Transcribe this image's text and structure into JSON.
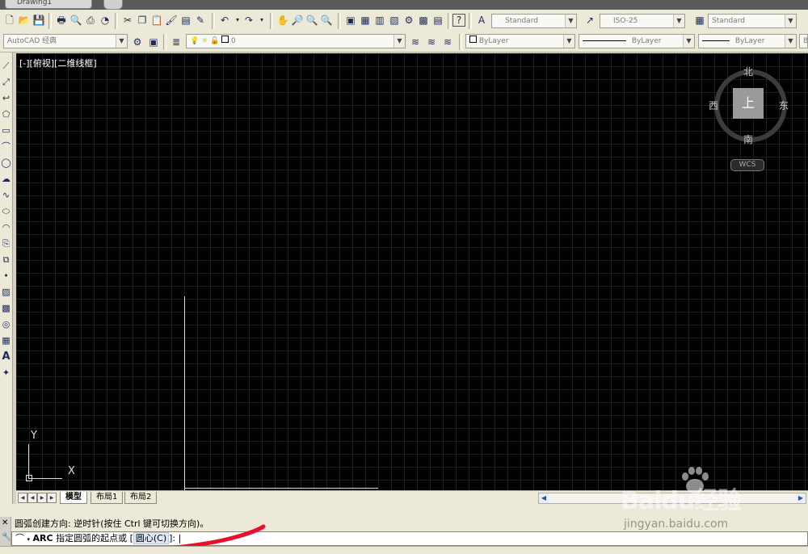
{
  "titlebar": {
    "document_tab": "Drawing1"
  },
  "toolbar1": {
    "text_style": "Standard",
    "dim_style": "ISO-25",
    "table_style": "Standard"
  },
  "toolbar2": {
    "workspace": "AutoCAD 经典",
    "layer": "0",
    "color": "ByLayer",
    "linetype": "ByLayer",
    "lineweight": "ByLayer",
    "plot_style": "ByLayer"
  },
  "viewport": {
    "label": "[-][俯视][二维线框]",
    "ucs": {
      "x_label": "X",
      "y_label": "Y"
    },
    "viewcube": {
      "north": "北",
      "south": "南",
      "east": "东",
      "west": "西",
      "top": "上",
      "wcs": "WCS"
    }
  },
  "layout_tabs": [
    "模型",
    "布局1",
    "布局2"
  ],
  "command": {
    "history": "圆弧创建方向: 逆时针(按住 Ctrl 键可切换方向)。",
    "name": "ARC",
    "prompt": "指定圆弧的起点或",
    "option_open": "[",
    "option": "圆心(C)",
    "option_close": "]: |"
  },
  "watermark": {
    "brand": "Baidu经验",
    "url": "jingyan.baidu.com"
  },
  "colors": {
    "canvas": "#000000",
    "grid": "#1e1e1e",
    "toolbar": "#ece9d8",
    "annotation": "#e8102a"
  },
  "icons": {
    "toolbar1": [
      "new-icon",
      "open-icon",
      "save-icon",
      "print-icon",
      "preview-icon",
      "publish-icon",
      "3d-print-icon",
      "cut-icon",
      "copy-icon",
      "paste-icon",
      "match-props-icon",
      "block-editor-icon",
      "undo-icon",
      "redo-icon",
      "pan-icon",
      "zoom-realtime-icon",
      "zoom-window-icon",
      "zoom-previous-icon",
      "properties-icon",
      "design-center-icon",
      "tool-palettes-icon",
      "sheet-set-icon",
      "markup-icon",
      "calculator-icon",
      "help-icon"
    ],
    "left": [
      "line-icon",
      "construction-line-icon",
      "polyline-icon",
      "polygon-icon",
      "rectangle-icon",
      "arc-icon",
      "circle-icon",
      "revision-cloud-icon",
      "spline-icon",
      "ellipse-icon",
      "ellipse-arc-icon",
      "insert-block-icon",
      "make-block-icon",
      "point-icon",
      "hatch-icon",
      "gradient-icon",
      "region-icon",
      "table-icon",
      "mtext-icon",
      "add-selected-icon"
    ]
  }
}
